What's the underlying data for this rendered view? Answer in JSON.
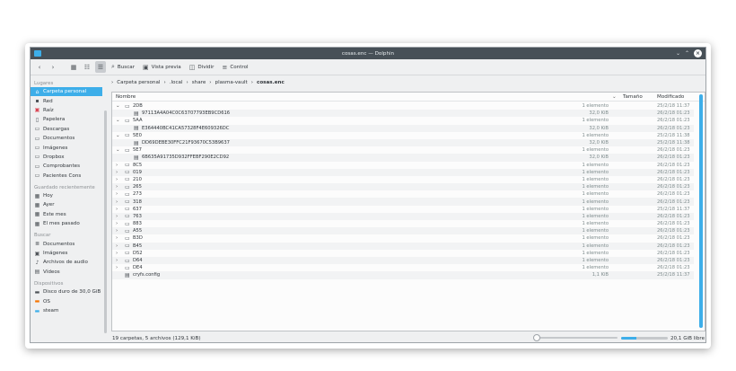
{
  "window": {
    "title": "cosas.enc — Dolphin"
  },
  "toolbar": {
    "search": "Buscar",
    "preview": "Vista previa",
    "split": "Dividir",
    "control": "Control"
  },
  "places": {
    "group_lugares": "Lugares",
    "lugares": [
      "Carpeta personal",
      "Red",
      "Raíz",
      "Papelera",
      "Descargas",
      "Documentos",
      "Imágenes",
      "Dropbox",
      "Comprobantes",
      "Pacientes Cons"
    ],
    "group_recent": "Guardado recientemente",
    "recent": [
      "Hoy",
      "Ayer",
      "Este mes",
      "El mes pasado"
    ],
    "group_search": "Buscar",
    "search": [
      "Documentos",
      "Imágenes",
      "Archivos de audio",
      "Vídeos"
    ],
    "group_devices": "Dispositivos",
    "devices": [
      "Disco duro de 30,0 GiB",
      "OS",
      "steam"
    ]
  },
  "breadcrumb": {
    "parts": [
      "Carpeta personal",
      ".local",
      "share",
      "plasma-vault"
    ],
    "current": "cosas.enc"
  },
  "columns": {
    "name": "Nombre",
    "size": "Tamaño",
    "modified": "Modificado"
  },
  "rows": [
    {
      "name": "2DB",
      "size": "1 elemento",
      "modified": "25/2/18 11:37",
      "expanded": true,
      "level": 0,
      "kind": "folder"
    },
    {
      "name": "97113A4A04C0C63707793EB9CD616",
      "size": "32,0 KiB",
      "modified": "26/2/18 01:23",
      "level": 1,
      "kind": "file"
    },
    {
      "name": "5AA",
      "size": "1 elemento",
      "modified": "26/2/18 01:23",
      "expanded": true,
      "level": 0,
      "kind": "folder"
    },
    {
      "name": "E364440BC41CA57328F4E609326DC",
      "size": "32,0 KiB",
      "modified": "26/2/18 01:23",
      "level": 1,
      "kind": "file"
    },
    {
      "name": "5E0",
      "size": "1 elemento",
      "modified": "25/2/18 11:38",
      "expanded": true,
      "level": 0,
      "kind": "folder"
    },
    {
      "name": "DD69DEBE30FFC21F93670C53B9637",
      "size": "32,0 KiB",
      "modified": "25/2/18 11:38",
      "level": 1,
      "kind": "file"
    },
    {
      "name": "5E7",
      "size": "1 elemento",
      "modified": "26/2/18 01:23",
      "expanded": true,
      "level": 0,
      "kind": "folder"
    },
    {
      "name": "6B635A91735D932FFEBF290E2CD92",
      "size": "32,0 KiB",
      "modified": "26/2/18 01:23",
      "level": 1,
      "kind": "file"
    },
    {
      "name": "8C5",
      "size": "1 elemento",
      "modified": "26/2/18 01:23",
      "expanded": false,
      "level": 0,
      "kind": "folder"
    },
    {
      "name": "019",
      "size": "1 elemento",
      "modified": "26/2/18 01:23",
      "expanded": false,
      "level": 0,
      "kind": "folder"
    },
    {
      "name": "210",
      "size": "1 elemento",
      "modified": "26/2/18 01:23",
      "expanded": false,
      "level": 0,
      "kind": "folder"
    },
    {
      "name": "265",
      "size": "1 elemento",
      "modified": "26/2/18 01:23",
      "expanded": false,
      "level": 0,
      "kind": "folder"
    },
    {
      "name": "273",
      "size": "1 elemento",
      "modified": "26/2/18 01:23",
      "expanded": false,
      "level": 0,
      "kind": "folder"
    },
    {
      "name": "318",
      "size": "1 elemento",
      "modified": "26/2/18 01:23",
      "expanded": false,
      "level": 0,
      "kind": "folder"
    },
    {
      "name": "637",
      "size": "1 elemento",
      "modified": "25/2/18 11:37",
      "expanded": false,
      "level": 0,
      "kind": "folder"
    },
    {
      "name": "763",
      "size": "1 elemento",
      "modified": "26/2/18 01:23",
      "expanded": false,
      "level": 0,
      "kind": "folder"
    },
    {
      "name": "883",
      "size": "1 elemento",
      "modified": "26/2/18 01:23",
      "expanded": false,
      "level": 0,
      "kind": "folder"
    },
    {
      "name": "A55",
      "size": "1 elemento",
      "modified": "26/2/18 01:23",
      "expanded": false,
      "level": 0,
      "kind": "folder"
    },
    {
      "name": "B3D",
      "size": "1 elemento",
      "modified": "26/2/18 01:23",
      "expanded": false,
      "level": 0,
      "kind": "folder"
    },
    {
      "name": "B45",
      "size": "1 elemento",
      "modified": "26/2/18 01:23",
      "expanded": false,
      "level": 0,
      "kind": "folder"
    },
    {
      "name": "D52",
      "size": "1 elemento",
      "modified": "26/2/18 01:23",
      "expanded": false,
      "level": 0,
      "kind": "folder"
    },
    {
      "name": "D64",
      "size": "1 elemento",
      "modified": "26/2/18 01:23",
      "expanded": false,
      "level": 0,
      "kind": "folder"
    },
    {
      "name": "DE4",
      "size": "1 elemento",
      "modified": "26/2/18 01:23",
      "expanded": false,
      "level": 0,
      "kind": "folder"
    },
    {
      "name": "cryfs.config",
      "size": "1,1 KiB",
      "modified": "25/2/18 11:37",
      "level": 0,
      "kind": "config"
    }
  ],
  "status": {
    "summary": "19 carpetas, 5 archivos (129,1 KiB)",
    "free": "20,1 GiB libre",
    "used_fraction": 0.33
  },
  "colors": {
    "accent": "#3daee9",
    "titlebar": "#475057"
  }
}
